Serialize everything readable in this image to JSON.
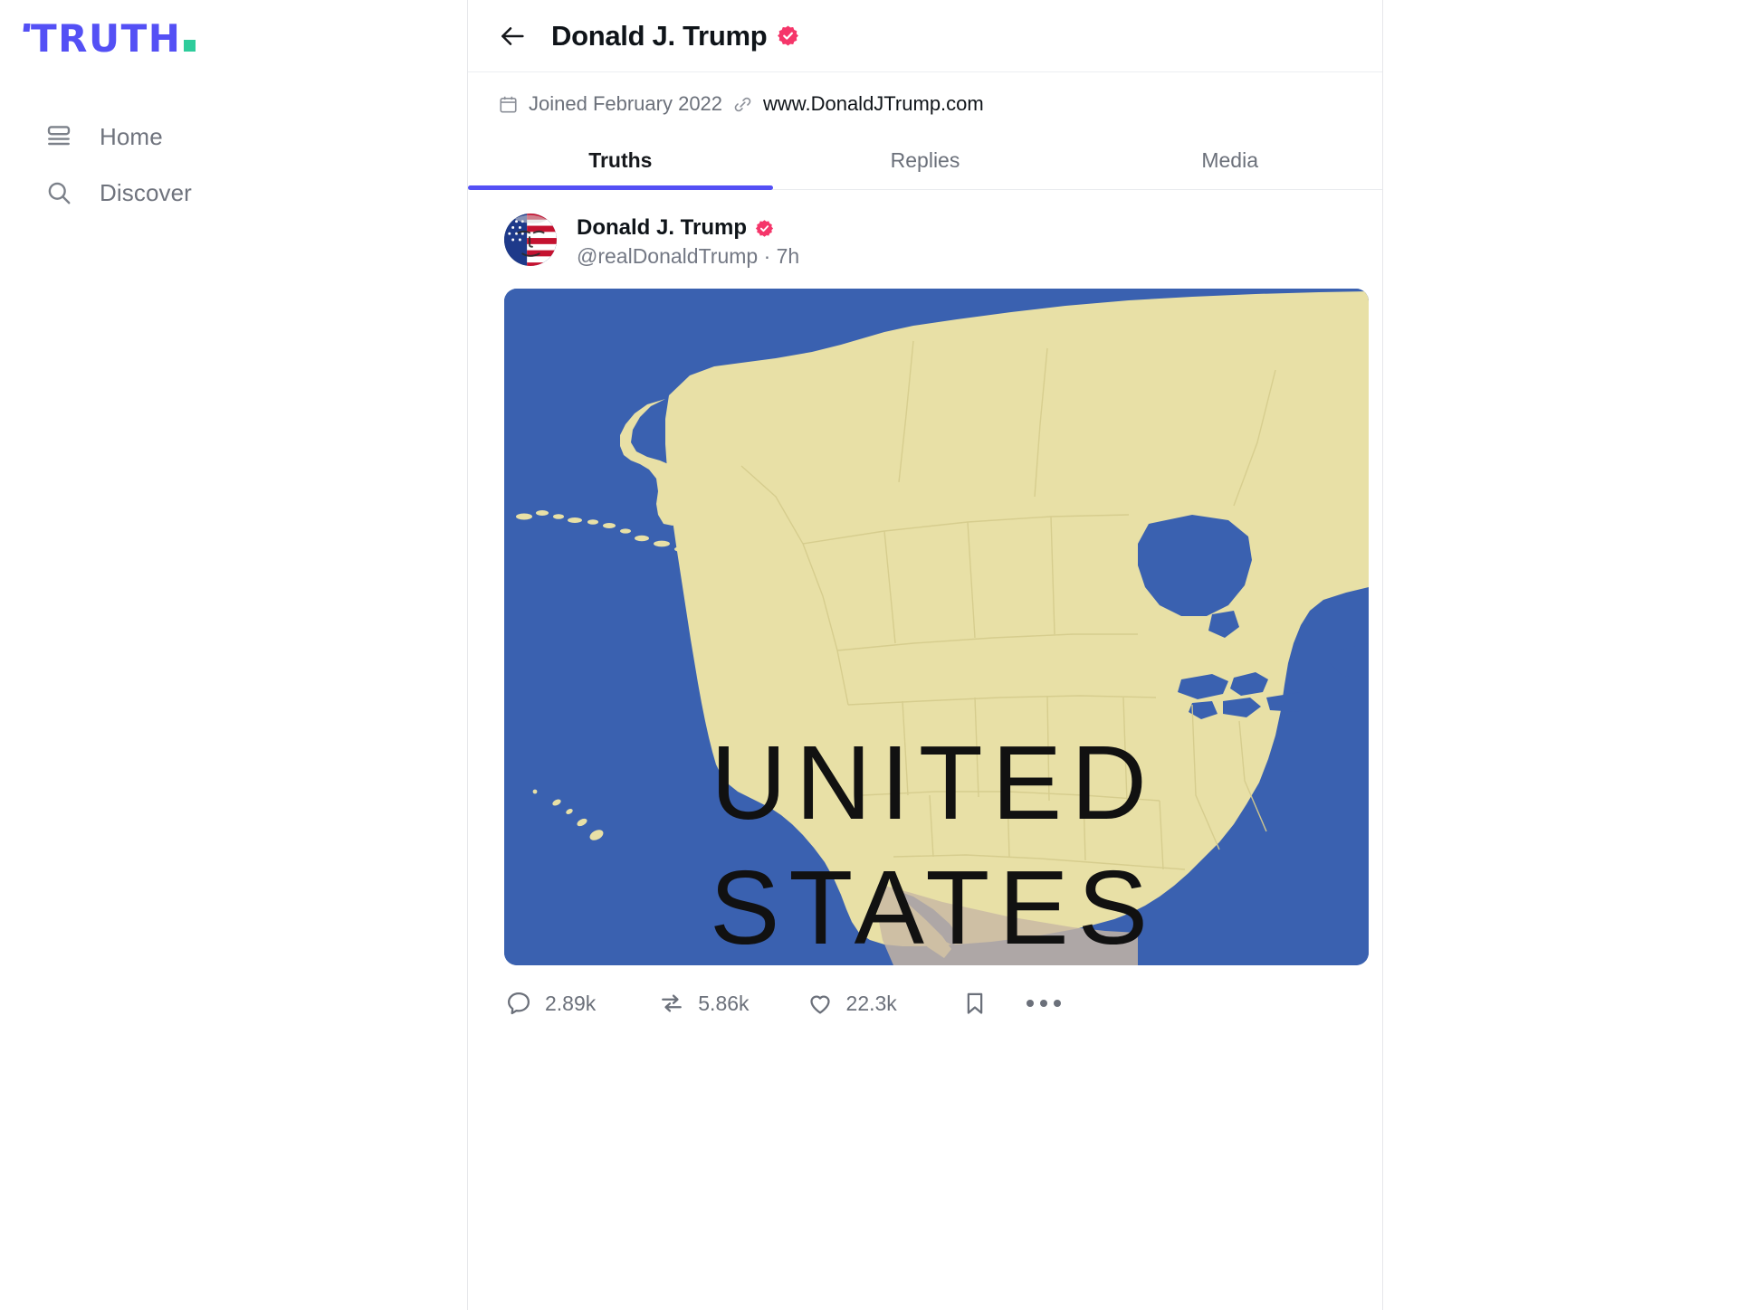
{
  "sidebar": {
    "brand": {
      "name": "TRUTH",
      "tick": "'",
      "dot_color": "#2ecc9b",
      "text_color": "#5450f5"
    },
    "items": [
      {
        "label": "Home",
        "icon": "home-feed-icon"
      },
      {
        "label": "Discover",
        "icon": "search-icon"
      }
    ]
  },
  "header": {
    "back_icon": "back-arrow-icon",
    "title": "Donald J. Trump",
    "verified_icon": "verified-badge-icon",
    "verified_color": "#f5366a"
  },
  "meta": {
    "calendar_icon": "calendar-icon",
    "joined": "Joined February 2022",
    "link_icon": "link-icon",
    "website": "www.DonaldJTrump.com"
  },
  "tabs": [
    {
      "label": "Truths",
      "active": true
    },
    {
      "label": "Replies",
      "active": false
    },
    {
      "label": "Media",
      "active": false
    }
  ],
  "tab_accent": "#5450f5",
  "post": {
    "avatar_name": "avatar-donald-j-trump",
    "author": "Donald J. Trump",
    "verified_icon": "verified-badge-icon",
    "handle_and_time": "@realDonaldTrump · 7h",
    "media": {
      "alt": "Map of North America labelled UNITED STATES",
      "label_line1": "UNITED",
      "label_line2": "STATES",
      "ocean_color": "#3a61b0",
      "land_color": "#e8e0a6",
      "label_color": "#111111"
    },
    "actions": [
      {
        "icon": "comment-icon",
        "count": "2.89k"
      },
      {
        "icon": "retruth-icon",
        "count": "5.86k"
      },
      {
        "icon": "heart-icon",
        "count": "22.3k"
      },
      {
        "icon": "bookmark-icon",
        "count": ""
      },
      {
        "icon": "more-options-icon",
        "count": ""
      }
    ]
  }
}
